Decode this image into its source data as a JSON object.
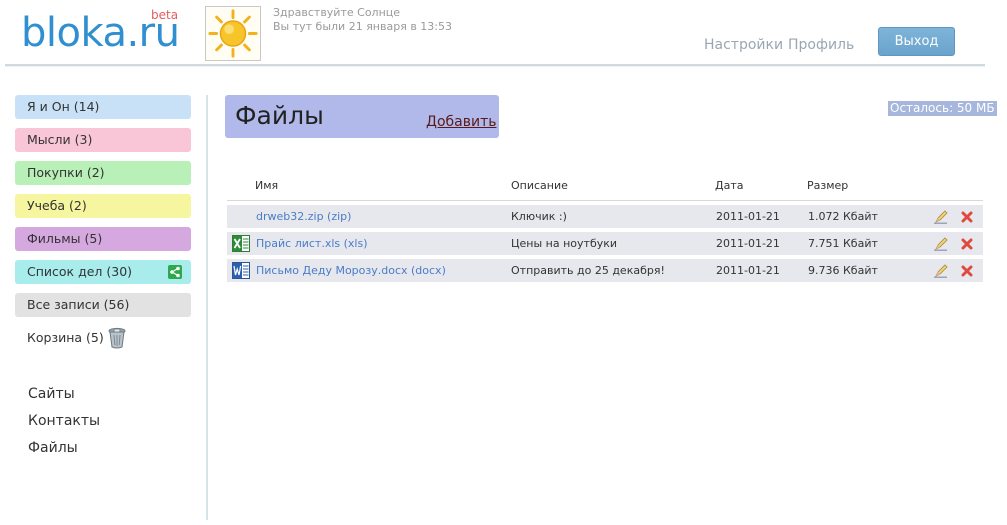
{
  "header": {
    "logo_text": "bloka.ru",
    "logo_beta": "beta",
    "greeting": "Здравствуйте Солнце",
    "last_visit": "Вы тут были 21 января в 13:53",
    "settings_label": "Настройки",
    "profile_label": "Профиль",
    "logout_label": "Выход",
    "logo_color": "#2f8fd0",
    "beta_color": "#e85b5b"
  },
  "sidebar": {
    "categories": [
      {
        "label": "Я и Он (14)",
        "color": "#c9e1f7"
      },
      {
        "label": "Мысли (3)",
        "color": "#f9c6d7"
      },
      {
        "label": "Покупки (2)",
        "color": "#b8f0b8"
      },
      {
        "label": "Учеба (2)",
        "color": "#f6f6a0"
      },
      {
        "label": "Фильмы (5)",
        "color": "#d6a8e0"
      },
      {
        "label": "Список дел (30)",
        "color": "#a8ecec",
        "icon": "share-icon"
      },
      {
        "label": "Все записи (56)",
        "color": "#e2e2e2"
      }
    ],
    "trash_label": "Корзина (5)",
    "links": [
      "Сайты",
      "Контакты",
      "Файлы"
    ]
  },
  "main": {
    "title": "Файлы",
    "add_label": "Добавить",
    "remaining": "Осталось: 50 МБ",
    "columns": {
      "name": "Имя",
      "description": "Описание",
      "date": "Дата",
      "size": "Размер"
    },
    "files": [
      {
        "name": "drweb32.zip (zip)",
        "description": "Ключик :)",
        "date": "2011-01-21",
        "size": "1.072 Кбайт",
        "icon": "none"
      },
      {
        "name": "Прайс лист.xls (xls)",
        "description": "Цены на ноутбуки",
        "date": "2011-01-21",
        "size": "7.751 Кбайт",
        "icon": "excel-file-icon"
      },
      {
        "name": "Письмо Деду Морозу.docx (docx)",
        "description": "Отправить до 25 декабря!",
        "date": "2011-01-21",
        "size": "9.736 Кбайт",
        "icon": "word-file-icon"
      }
    ]
  }
}
